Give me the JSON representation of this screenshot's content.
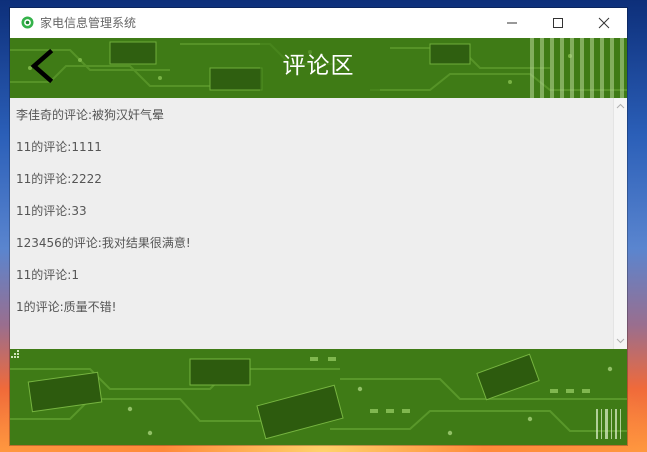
{
  "window": {
    "title": "家电信息管理系统"
  },
  "header": {
    "title": "评论区"
  },
  "comments": [
    "李佳奇的评论:被狗汉奸气晕",
    "11的评论:1111",
    "11的评论:2222",
    "11的评论:33",
    "123456的评论:我对结果很满意!",
    "11的评论:1",
    "1的评论:质量不错!"
  ],
  "icons": {
    "app": "app-logo-icon",
    "back": "back-arrow-icon",
    "minimize": "minimize-icon",
    "maximize": "maximize-icon",
    "close": "close-icon"
  },
  "colors": {
    "header_green": "#3e7a15",
    "content_bg": "#eeeeee",
    "title_text": "#ffffff",
    "comment_text": "#555555"
  }
}
